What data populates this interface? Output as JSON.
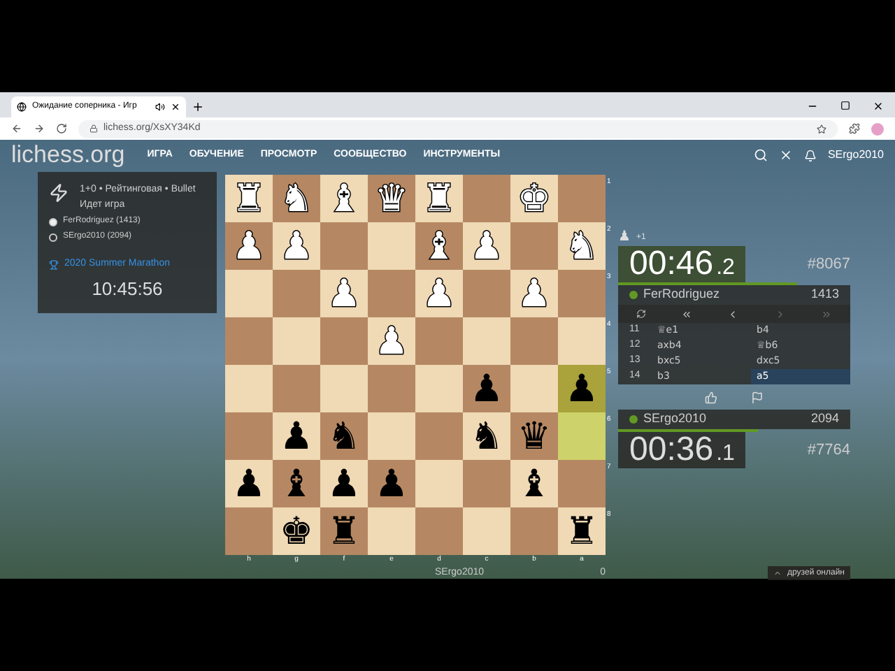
{
  "browser": {
    "tab": {
      "title": "Ожидание соперника - Игр",
      "selected": true
    },
    "address": "lichess.org/XsXY34Kd"
  },
  "site": {
    "logo": "lichess.org",
    "nav": [
      "ИГРА",
      "ОБУЧЕНИЕ",
      "ПРОСМОТР",
      "СООБЩЕСТВО",
      "ИНСТРУМЕНТЫ"
    ],
    "user": "SErgo2010"
  },
  "game_info": {
    "line": "1+0 • Рейтинговая • Bullet",
    "status": "Идет игра",
    "players": [
      {
        "name": "FerRodriguez (1413)",
        "white": true
      },
      {
        "name": "SErgo2010 (2094)",
        "white": false
      }
    ],
    "tournament": "2020 Summer Marathon",
    "time": "10:45:56"
  },
  "board": {
    "ranks": [
      [
        {
          "piece": "♜",
          "white": true,
          "last_move": false
        },
        {
          "piece": "♞",
          "white": true,
          "last_move": false
        },
        {
          "piece": "♝",
          "white": true,
          "last_move": false
        },
        {
          "piece": "♛",
          "white": true,
          "last_move": false
        },
        {
          "piece": "♜",
          "white": true,
          "last_move": false
        },
        {
          "last_move": false
        },
        {
          "piece": "♚",
          "white": true,
          "last_move": false
        },
        {
          "last_move": false
        }
      ],
      [
        {
          "piece": "♟",
          "white": true,
          "last_move": false
        },
        {
          "piece": "♟",
          "white": true,
          "last_move": false
        },
        {
          "last_move": false
        },
        {
          "last_move": false
        },
        {
          "piece": "♝",
          "white": true,
          "last_move": false
        },
        {
          "piece": "♟",
          "white": true,
          "last_move": false
        },
        {
          "last_move": false
        },
        {
          "piece": "♞",
          "white": true,
          "last_move": false
        }
      ],
      [
        {
          "last_move": false
        },
        {
          "last_move": false
        },
        {
          "piece": "♟",
          "white": true,
          "last_move": false
        },
        {
          "last_move": false
        },
        {
          "piece": "♟",
          "white": true,
          "last_move": false
        },
        {
          "last_move": false
        },
        {
          "piece": "♟",
          "white": true,
          "last_move": false
        },
        {
          "last_move": false
        }
      ],
      [
        {
          "last_move": false
        },
        {
          "last_move": false
        },
        {
          "last_move": false
        },
        {
          "piece": "♟",
          "white": true,
          "last_move": false
        },
        {
          "last_move": false
        },
        {
          "last_move": false
        },
        {
          "last_move": false
        },
        {
          "last_move": false
        }
      ],
      [
        {
          "last_move": false
        },
        {
          "last_move": false
        },
        {
          "last_move": false
        },
        {
          "last_move": false
        },
        {
          "last_move": false
        },
        {
          "piece": "♟",
          "white": false,
          "last_move": false
        },
        {
          "last_move": false
        },
        {
          "piece": "♟",
          "white": false,
          "last_move": true
        }
      ],
      [
        {
          "last_move": false
        },
        {
          "piece": "♟",
          "white": false,
          "last_move": false
        },
        {
          "piece": "♞",
          "white": false,
          "last_move": false
        },
        {
          "last_move": false
        },
        {
          "last_move": false
        },
        {
          "piece": "♞",
          "white": false,
          "last_move": false
        },
        {
          "piece": "♛",
          "white": false,
          "last_move": false
        },
        {
          "last_move": true
        }
      ],
      [
        {
          "piece": "♟",
          "white": false,
          "last_move": false
        },
        {
          "piece": "♝",
          "white": false,
          "last_move": false
        },
        {
          "piece": "♟",
          "white": false,
          "last_move": false
        },
        {
          "piece": "♟",
          "white": false,
          "last_move": false
        },
        {
          "last_move": false
        },
        {
          "last_move": false
        },
        {
          "piece": "♝",
          "white": false,
          "last_move": false
        },
        {
          "last_move": false
        }
      ],
      [
        {
          "last_move": false
        },
        {
          "piece": "♚",
          "white": false,
          "last_move": false
        },
        {
          "piece": "♜",
          "white": false,
          "last_move": false
        },
        {
          "last_move": false
        },
        {
          "last_move": false
        },
        {
          "last_move": false
        },
        {
          "last_move": false
        },
        {
          "piece": "♜",
          "white": false,
          "last_move": false
        }
      ]
    ],
    "rank_labels": [
      "1",
      "2",
      "3",
      "4",
      "5",
      "6",
      "7",
      "8"
    ],
    "file_labels": [
      "h",
      "g",
      "f",
      "e",
      "d",
      "c",
      "b",
      "a"
    ],
    "bottom_player": "SErgo2010",
    "bottom_score": "0"
  },
  "top": {
    "material_icon": "♟",
    "material": "+1",
    "clock": {
      "main": "00:46",
      "tenths": ".2",
      "running": true
    },
    "rank": "#8067",
    "player": {
      "name": "FerRodriguez",
      "rating": "1413",
      "online": true
    }
  },
  "moves": [
    {
      "number": "11",
      "white": {
        "text": "♕e1",
        "selected": false
      },
      "black": {
        "text": "b4",
        "selected": false
      }
    },
    {
      "number": "12",
      "white": {
        "text": "axb4",
        "selected": false
      },
      "black": {
        "text": "♕b6",
        "selected": false
      }
    },
    {
      "number": "13",
      "white": {
        "text": "bxc5",
        "selected": false
      },
      "black": {
        "text": "dxc5",
        "selected": false
      }
    },
    {
      "number": "14",
      "white": {
        "text": "b3",
        "selected": false
      },
      "black": {
        "text": "a5",
        "selected": true
      }
    }
  ],
  "bottom": {
    "player": {
      "name": "SErgo2010",
      "rating": "2094",
      "online": true
    },
    "clock": {
      "main": "00:36",
      "tenths": ".1",
      "running": false
    },
    "rank": "#7764"
  },
  "friends": "друзей онлайн"
}
